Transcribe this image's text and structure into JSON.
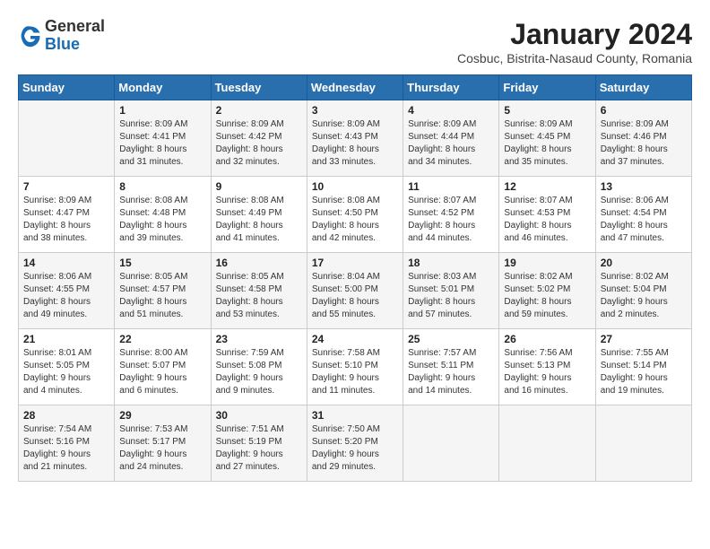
{
  "header": {
    "logo_general": "General",
    "logo_blue": "Blue",
    "month_title": "January 2024",
    "location": "Cosbuc, Bistrita-Nasaud County, Romania"
  },
  "weekdays": [
    "Sunday",
    "Monday",
    "Tuesday",
    "Wednesday",
    "Thursday",
    "Friday",
    "Saturday"
  ],
  "weeks": [
    [
      {
        "day": "",
        "info": ""
      },
      {
        "day": "1",
        "info": "Sunrise: 8:09 AM\nSunset: 4:41 PM\nDaylight: 8 hours\nand 31 minutes."
      },
      {
        "day": "2",
        "info": "Sunrise: 8:09 AM\nSunset: 4:42 PM\nDaylight: 8 hours\nand 32 minutes."
      },
      {
        "day": "3",
        "info": "Sunrise: 8:09 AM\nSunset: 4:43 PM\nDaylight: 8 hours\nand 33 minutes."
      },
      {
        "day": "4",
        "info": "Sunrise: 8:09 AM\nSunset: 4:44 PM\nDaylight: 8 hours\nand 34 minutes."
      },
      {
        "day": "5",
        "info": "Sunrise: 8:09 AM\nSunset: 4:45 PM\nDaylight: 8 hours\nand 35 minutes."
      },
      {
        "day": "6",
        "info": "Sunrise: 8:09 AM\nSunset: 4:46 PM\nDaylight: 8 hours\nand 37 minutes."
      }
    ],
    [
      {
        "day": "7",
        "info": "Sunrise: 8:09 AM\nSunset: 4:47 PM\nDaylight: 8 hours\nand 38 minutes."
      },
      {
        "day": "8",
        "info": "Sunrise: 8:08 AM\nSunset: 4:48 PM\nDaylight: 8 hours\nand 39 minutes."
      },
      {
        "day": "9",
        "info": "Sunrise: 8:08 AM\nSunset: 4:49 PM\nDaylight: 8 hours\nand 41 minutes."
      },
      {
        "day": "10",
        "info": "Sunrise: 8:08 AM\nSunset: 4:50 PM\nDaylight: 8 hours\nand 42 minutes."
      },
      {
        "day": "11",
        "info": "Sunrise: 8:07 AM\nSunset: 4:52 PM\nDaylight: 8 hours\nand 44 minutes."
      },
      {
        "day": "12",
        "info": "Sunrise: 8:07 AM\nSunset: 4:53 PM\nDaylight: 8 hours\nand 46 minutes."
      },
      {
        "day": "13",
        "info": "Sunrise: 8:06 AM\nSunset: 4:54 PM\nDaylight: 8 hours\nand 47 minutes."
      }
    ],
    [
      {
        "day": "14",
        "info": "Sunrise: 8:06 AM\nSunset: 4:55 PM\nDaylight: 8 hours\nand 49 minutes."
      },
      {
        "day": "15",
        "info": "Sunrise: 8:05 AM\nSunset: 4:57 PM\nDaylight: 8 hours\nand 51 minutes."
      },
      {
        "day": "16",
        "info": "Sunrise: 8:05 AM\nSunset: 4:58 PM\nDaylight: 8 hours\nand 53 minutes."
      },
      {
        "day": "17",
        "info": "Sunrise: 8:04 AM\nSunset: 5:00 PM\nDaylight: 8 hours\nand 55 minutes."
      },
      {
        "day": "18",
        "info": "Sunrise: 8:03 AM\nSunset: 5:01 PM\nDaylight: 8 hours\nand 57 minutes."
      },
      {
        "day": "19",
        "info": "Sunrise: 8:02 AM\nSunset: 5:02 PM\nDaylight: 8 hours\nand 59 minutes."
      },
      {
        "day": "20",
        "info": "Sunrise: 8:02 AM\nSunset: 5:04 PM\nDaylight: 9 hours\nand 2 minutes."
      }
    ],
    [
      {
        "day": "21",
        "info": "Sunrise: 8:01 AM\nSunset: 5:05 PM\nDaylight: 9 hours\nand 4 minutes."
      },
      {
        "day": "22",
        "info": "Sunrise: 8:00 AM\nSunset: 5:07 PM\nDaylight: 9 hours\nand 6 minutes."
      },
      {
        "day": "23",
        "info": "Sunrise: 7:59 AM\nSunset: 5:08 PM\nDaylight: 9 hours\nand 9 minutes."
      },
      {
        "day": "24",
        "info": "Sunrise: 7:58 AM\nSunset: 5:10 PM\nDaylight: 9 hours\nand 11 minutes."
      },
      {
        "day": "25",
        "info": "Sunrise: 7:57 AM\nSunset: 5:11 PM\nDaylight: 9 hours\nand 14 minutes."
      },
      {
        "day": "26",
        "info": "Sunrise: 7:56 AM\nSunset: 5:13 PM\nDaylight: 9 hours\nand 16 minutes."
      },
      {
        "day": "27",
        "info": "Sunrise: 7:55 AM\nSunset: 5:14 PM\nDaylight: 9 hours\nand 19 minutes."
      }
    ],
    [
      {
        "day": "28",
        "info": "Sunrise: 7:54 AM\nSunset: 5:16 PM\nDaylight: 9 hours\nand 21 minutes."
      },
      {
        "day": "29",
        "info": "Sunrise: 7:53 AM\nSunset: 5:17 PM\nDaylight: 9 hours\nand 24 minutes."
      },
      {
        "day": "30",
        "info": "Sunrise: 7:51 AM\nSunset: 5:19 PM\nDaylight: 9 hours\nand 27 minutes."
      },
      {
        "day": "31",
        "info": "Sunrise: 7:50 AM\nSunset: 5:20 PM\nDaylight: 9 hours\nand 29 minutes."
      },
      {
        "day": "",
        "info": ""
      },
      {
        "day": "",
        "info": ""
      },
      {
        "day": "",
        "info": ""
      }
    ]
  ]
}
